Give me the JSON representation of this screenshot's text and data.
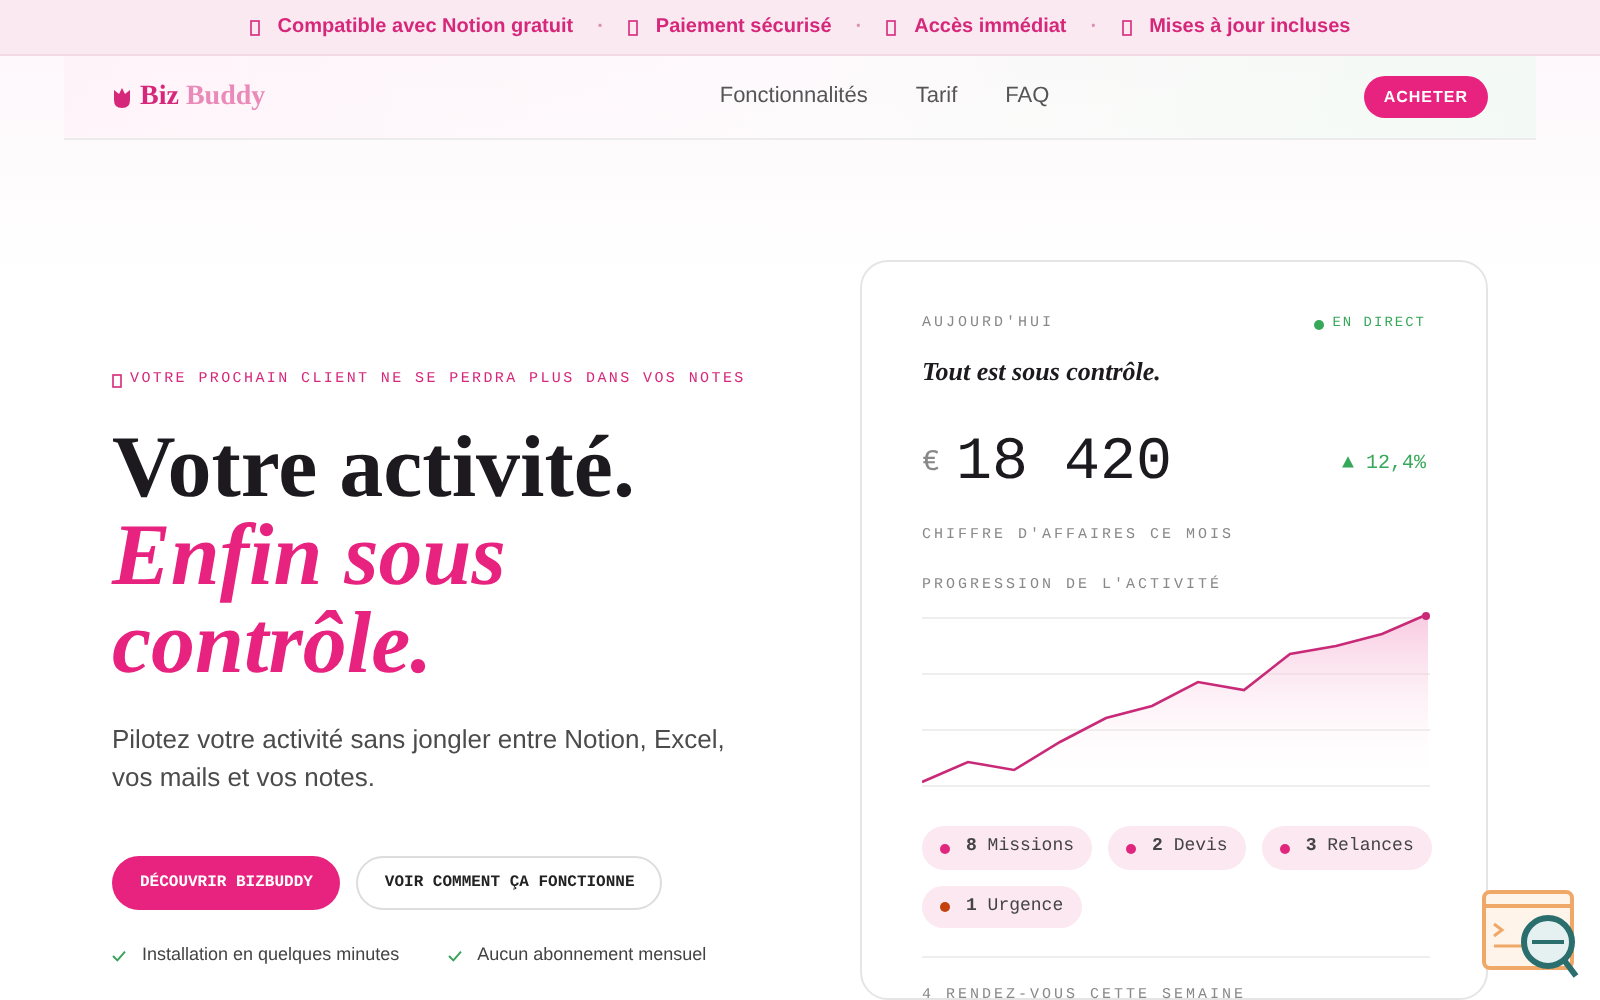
{
  "banner": {
    "items": [
      "Compatible avec Notion gratuit",
      "Paiement sécurisé",
      "Accès immédiat",
      "Mises à jour incluses"
    ],
    "separator": "·"
  },
  "navbar": {
    "logo_first": "Biz",
    "logo_second": "Buddy",
    "links": [
      "Fonctionnalités",
      "Tarif",
      "FAQ"
    ],
    "cta": "ACHETER"
  },
  "hero": {
    "eyebrow": "VOTRE PROCHAIN CLIENT NE SE PERDRA PLUS DANS VOS NOTES",
    "title_line": "Votre activité.",
    "title_accent_lines": [
      "Enfin sous",
      "contrôle."
    ],
    "lead": "Pilotez votre activité sans jongler entre Notion, Excel, vos mails et vos notes.",
    "primary_button": "DÉCOUVRIR BIZBUDDY",
    "secondary_button": "VOIR COMMENT ÇA FONCTIONNE",
    "perks": [
      "Installation en quelques minutes",
      "Aucun abonnement mensuel"
    ]
  },
  "dashboard": {
    "kicker": "AUJOURD'HUI",
    "live": "EN DIRECT",
    "headline": "Tout est sous contrôle.",
    "currency": "€",
    "amount": "18 420",
    "trend": "▲ 12,4%",
    "amount_label": "CHIFFRE D'AFFAIRES CE MOIS",
    "chart_label": "PROGRESSION DE L'ACTIVITÉ",
    "pills": [
      {
        "count": "8",
        "label": "Missions",
        "color": "#e0267d"
      },
      {
        "count": "2",
        "label": "Devis",
        "color": "#e0267d"
      },
      {
        "count": "3",
        "label": "Relances",
        "color": "#e0267d"
      },
      {
        "count": "1",
        "label": "Urgence",
        "color": "#c2410c"
      }
    ],
    "footer": "4 RENDEZ-VOUS CETTE SEMAINE"
  }
}
